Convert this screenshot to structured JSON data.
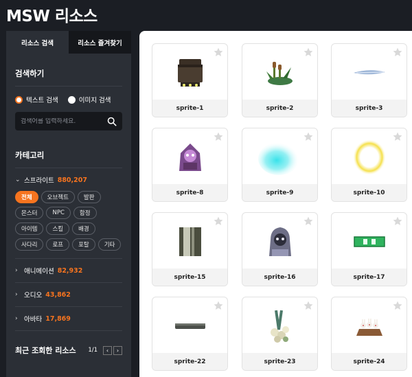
{
  "app_title": "MSW 리소스",
  "tabs": [
    {
      "label": "리소스 검색",
      "active": true
    },
    {
      "label": "리소스 즐겨찾기",
      "active": false
    }
  ],
  "search": {
    "section_title": "검색하기",
    "modes": [
      {
        "label": "텍스트 검색",
        "selected": true
      },
      {
        "label": "이미지 검색",
        "selected": false
      }
    ],
    "placeholder": "검색어를 입력하세요.",
    "icon": "search-icon"
  },
  "categories": {
    "title": "카테고리",
    "sprite": {
      "label": "스프라이트",
      "count": "880,207",
      "expanded": true
    },
    "chips": [
      {
        "label": "전체",
        "active": true
      },
      {
        "label": "오브젝트",
        "active": false
      },
      {
        "label": "발판",
        "active": false
      },
      {
        "label": "몬스터",
        "active": false
      },
      {
        "label": "NPC",
        "active": false
      },
      {
        "label": "함정",
        "active": false
      },
      {
        "label": "아이템",
        "active": false
      },
      {
        "label": "스킬",
        "active": false
      },
      {
        "label": "배경",
        "active": false
      },
      {
        "label": "사다리",
        "active": false
      },
      {
        "label": "로프",
        "active": false
      },
      {
        "label": "포탈",
        "active": false
      },
      {
        "label": "기타",
        "active": false
      }
    ],
    "collapsed": [
      {
        "label": "애니메이션",
        "count": "82,932"
      },
      {
        "label": "오디오",
        "count": "43,862"
      },
      {
        "label": "아바타",
        "count": "17,869"
      }
    ]
  },
  "recent": {
    "title": "최근 조회한 리소스",
    "page": "1/1",
    "prev": "‹",
    "next": "›"
  },
  "grid": {
    "items": [
      {
        "label": "sprite-1",
        "icon": "chest-icon"
      },
      {
        "label": "sprite-2",
        "icon": "cattail-plant-icon"
      },
      {
        "label": "sprite-3",
        "icon": "feather-blade-icon"
      },
      {
        "label": "sprite-8",
        "icon": "cloaked-monster-icon"
      },
      {
        "label": "sprite-9",
        "icon": "cyan-glow-icon"
      },
      {
        "label": "sprite-10",
        "icon": "yellow-ring-icon"
      },
      {
        "label": "sprite-15",
        "icon": "pillar-icon"
      },
      {
        "label": "sprite-16",
        "icon": "hooded-figure-icon"
      },
      {
        "label": "sprite-17",
        "icon": "green-sign-icon"
      },
      {
        "label": "sprite-22",
        "icon": "stone-platform-icon"
      },
      {
        "label": "sprite-23",
        "icon": "vine-flower-icon"
      },
      {
        "label": "sprite-24",
        "icon": "bunny-cart-icon"
      }
    ],
    "star_icon": "star-icon"
  },
  "colors": {
    "accent": "#f7741f",
    "sidebar_bg": "#2b2f36",
    "page_bg": "#1b1e24"
  }
}
